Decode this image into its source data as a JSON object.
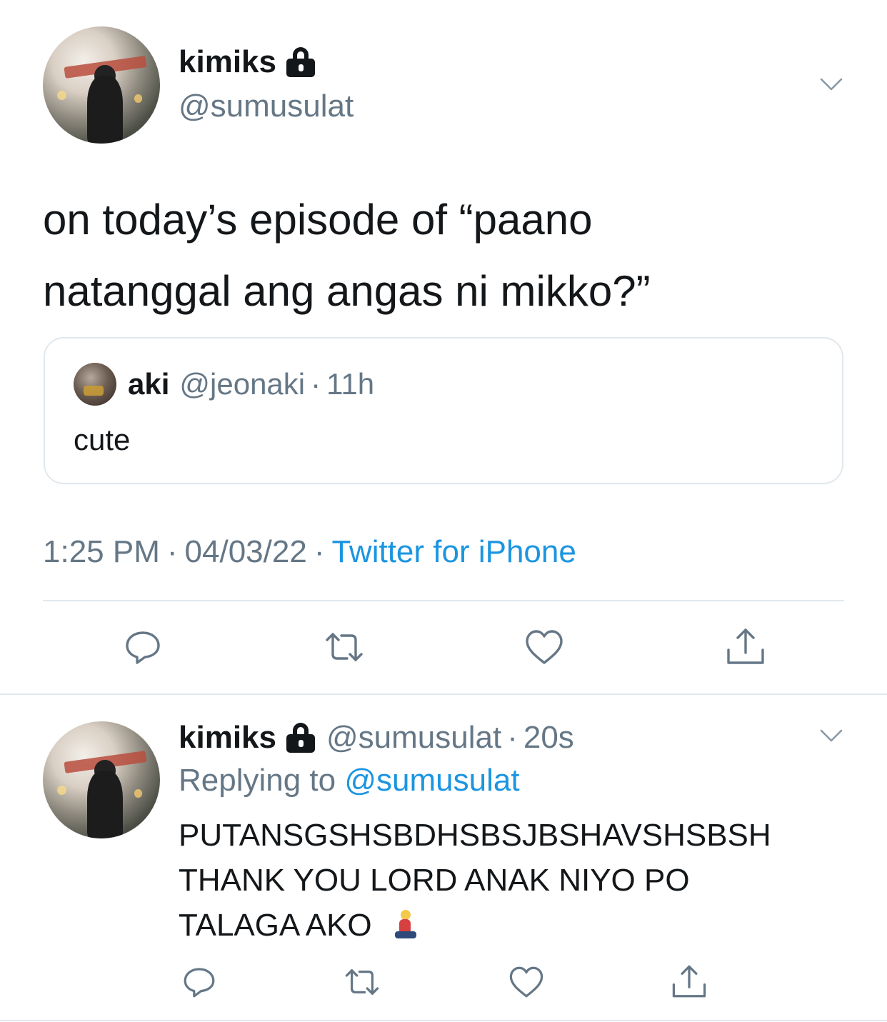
{
  "tweet": {
    "display_name": "kimiks",
    "handle": "@sumusulat",
    "text_line_1": "on today’s episode of “paano",
    "text_line_2": "natanggal ang angas ni mikko?”",
    "quote": {
      "display_name": "aki",
      "handle": "@jeonaki",
      "separator": "·",
      "time": "11h",
      "text": "cute"
    },
    "meta": {
      "time": "1:25 PM",
      "separator": "·",
      "date": "04/03/22",
      "source": "Twitter for iPhone"
    }
  },
  "reply": {
    "display_name": "kimiks",
    "handle": "@sumusulat",
    "separator": "·",
    "time": "20s",
    "replying_prefix": "Replying to",
    "replying_mention": "@sumusulat",
    "text_line_1": "PUTANSGSHSBDHSBSJBSHAVSHSBSH",
    "text_line_2": "THANK YOU LORD ANAK NIYO PO",
    "text_line_3": "TALAGA AKO"
  },
  "icons": {
    "lock": "lock-icon",
    "chevron": "chevron-down-icon",
    "reply": "reply-icon",
    "retweet": "retweet-icon",
    "like": "heart-icon",
    "share": "share-icon",
    "emoji": "person-kneeling-emoji"
  },
  "colors": {
    "text": "#14171a",
    "secondary": "#657786",
    "link": "#1b95e0",
    "divider": "#e1e8ed"
  }
}
